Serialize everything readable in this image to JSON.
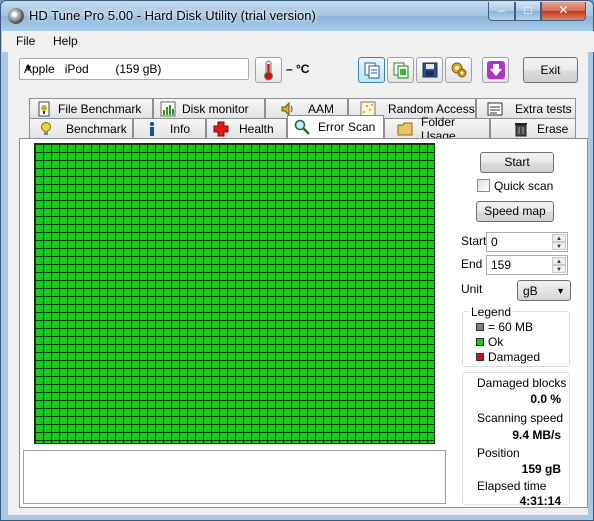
{
  "window": {
    "title": "HD Tune Pro 5.00 - Hard Disk Utility (trial version)",
    "minimize": "–",
    "maximize": "□",
    "close": "✕"
  },
  "menu": {
    "file": "File",
    "help": "Help"
  },
  "toolbar": {
    "drive": "Apple   iPod        (159 gB)",
    "temperature": "– °C",
    "exit": "Exit",
    "icons": [
      "copy-info-icon",
      "copy-screenshot-icon",
      "save-icon",
      "options-icon",
      "download-icon"
    ]
  },
  "tabs": {
    "row1": [
      {
        "label": "File Benchmark",
        "icon": "file-benchmark-icon"
      },
      {
        "label": "Disk monitor",
        "icon": "disk-monitor-icon"
      },
      {
        "label": "AAM",
        "icon": "speaker-icon"
      },
      {
        "label": "Random Access",
        "icon": "random-access-icon"
      },
      {
        "label": "Extra tests",
        "icon": "extra-tests-icon"
      }
    ],
    "row2": [
      {
        "label": "Benchmark",
        "icon": "lightbulb-icon"
      },
      {
        "label": "Info",
        "icon": "info-icon"
      },
      {
        "label": "Health",
        "icon": "health-cross-icon"
      },
      {
        "label": "Error Scan",
        "icon": "magnifier-icon"
      },
      {
        "label": "Folder Usage",
        "icon": "folder-icon"
      },
      {
        "label": "Erase",
        "icon": "trash-icon"
      }
    ],
    "selected": "Error Scan"
  },
  "error_scan": {
    "start_button": "Start",
    "quick_scan_label": "Quick scan",
    "quick_scan_checked": false,
    "speed_map_button": "Speed map",
    "start_label": "Start",
    "start_value": "0",
    "end_label": "End",
    "end_value": "159",
    "unit_label": "Unit",
    "unit_value": "gB",
    "legend": {
      "title": "Legend",
      "block_size": "= 60 MB",
      "ok": "Ok",
      "damaged": "Damaged",
      "colors": {
        "block": "#808080",
        "ok": "#1cc81c",
        "damaged": "#d01010"
      }
    },
    "stats": {
      "damaged_blocks_label": "Damaged blocks",
      "damaged_blocks_value": "0.0 %",
      "scanning_speed_label": "Scanning speed",
      "scanning_speed_value": "9.4 MB/s",
      "position_label": "Position",
      "position_value": "159 gB",
      "elapsed_label": "Elapsed time",
      "elapsed_value": "4:31:14"
    },
    "grid_color": "#1cc81c"
  }
}
